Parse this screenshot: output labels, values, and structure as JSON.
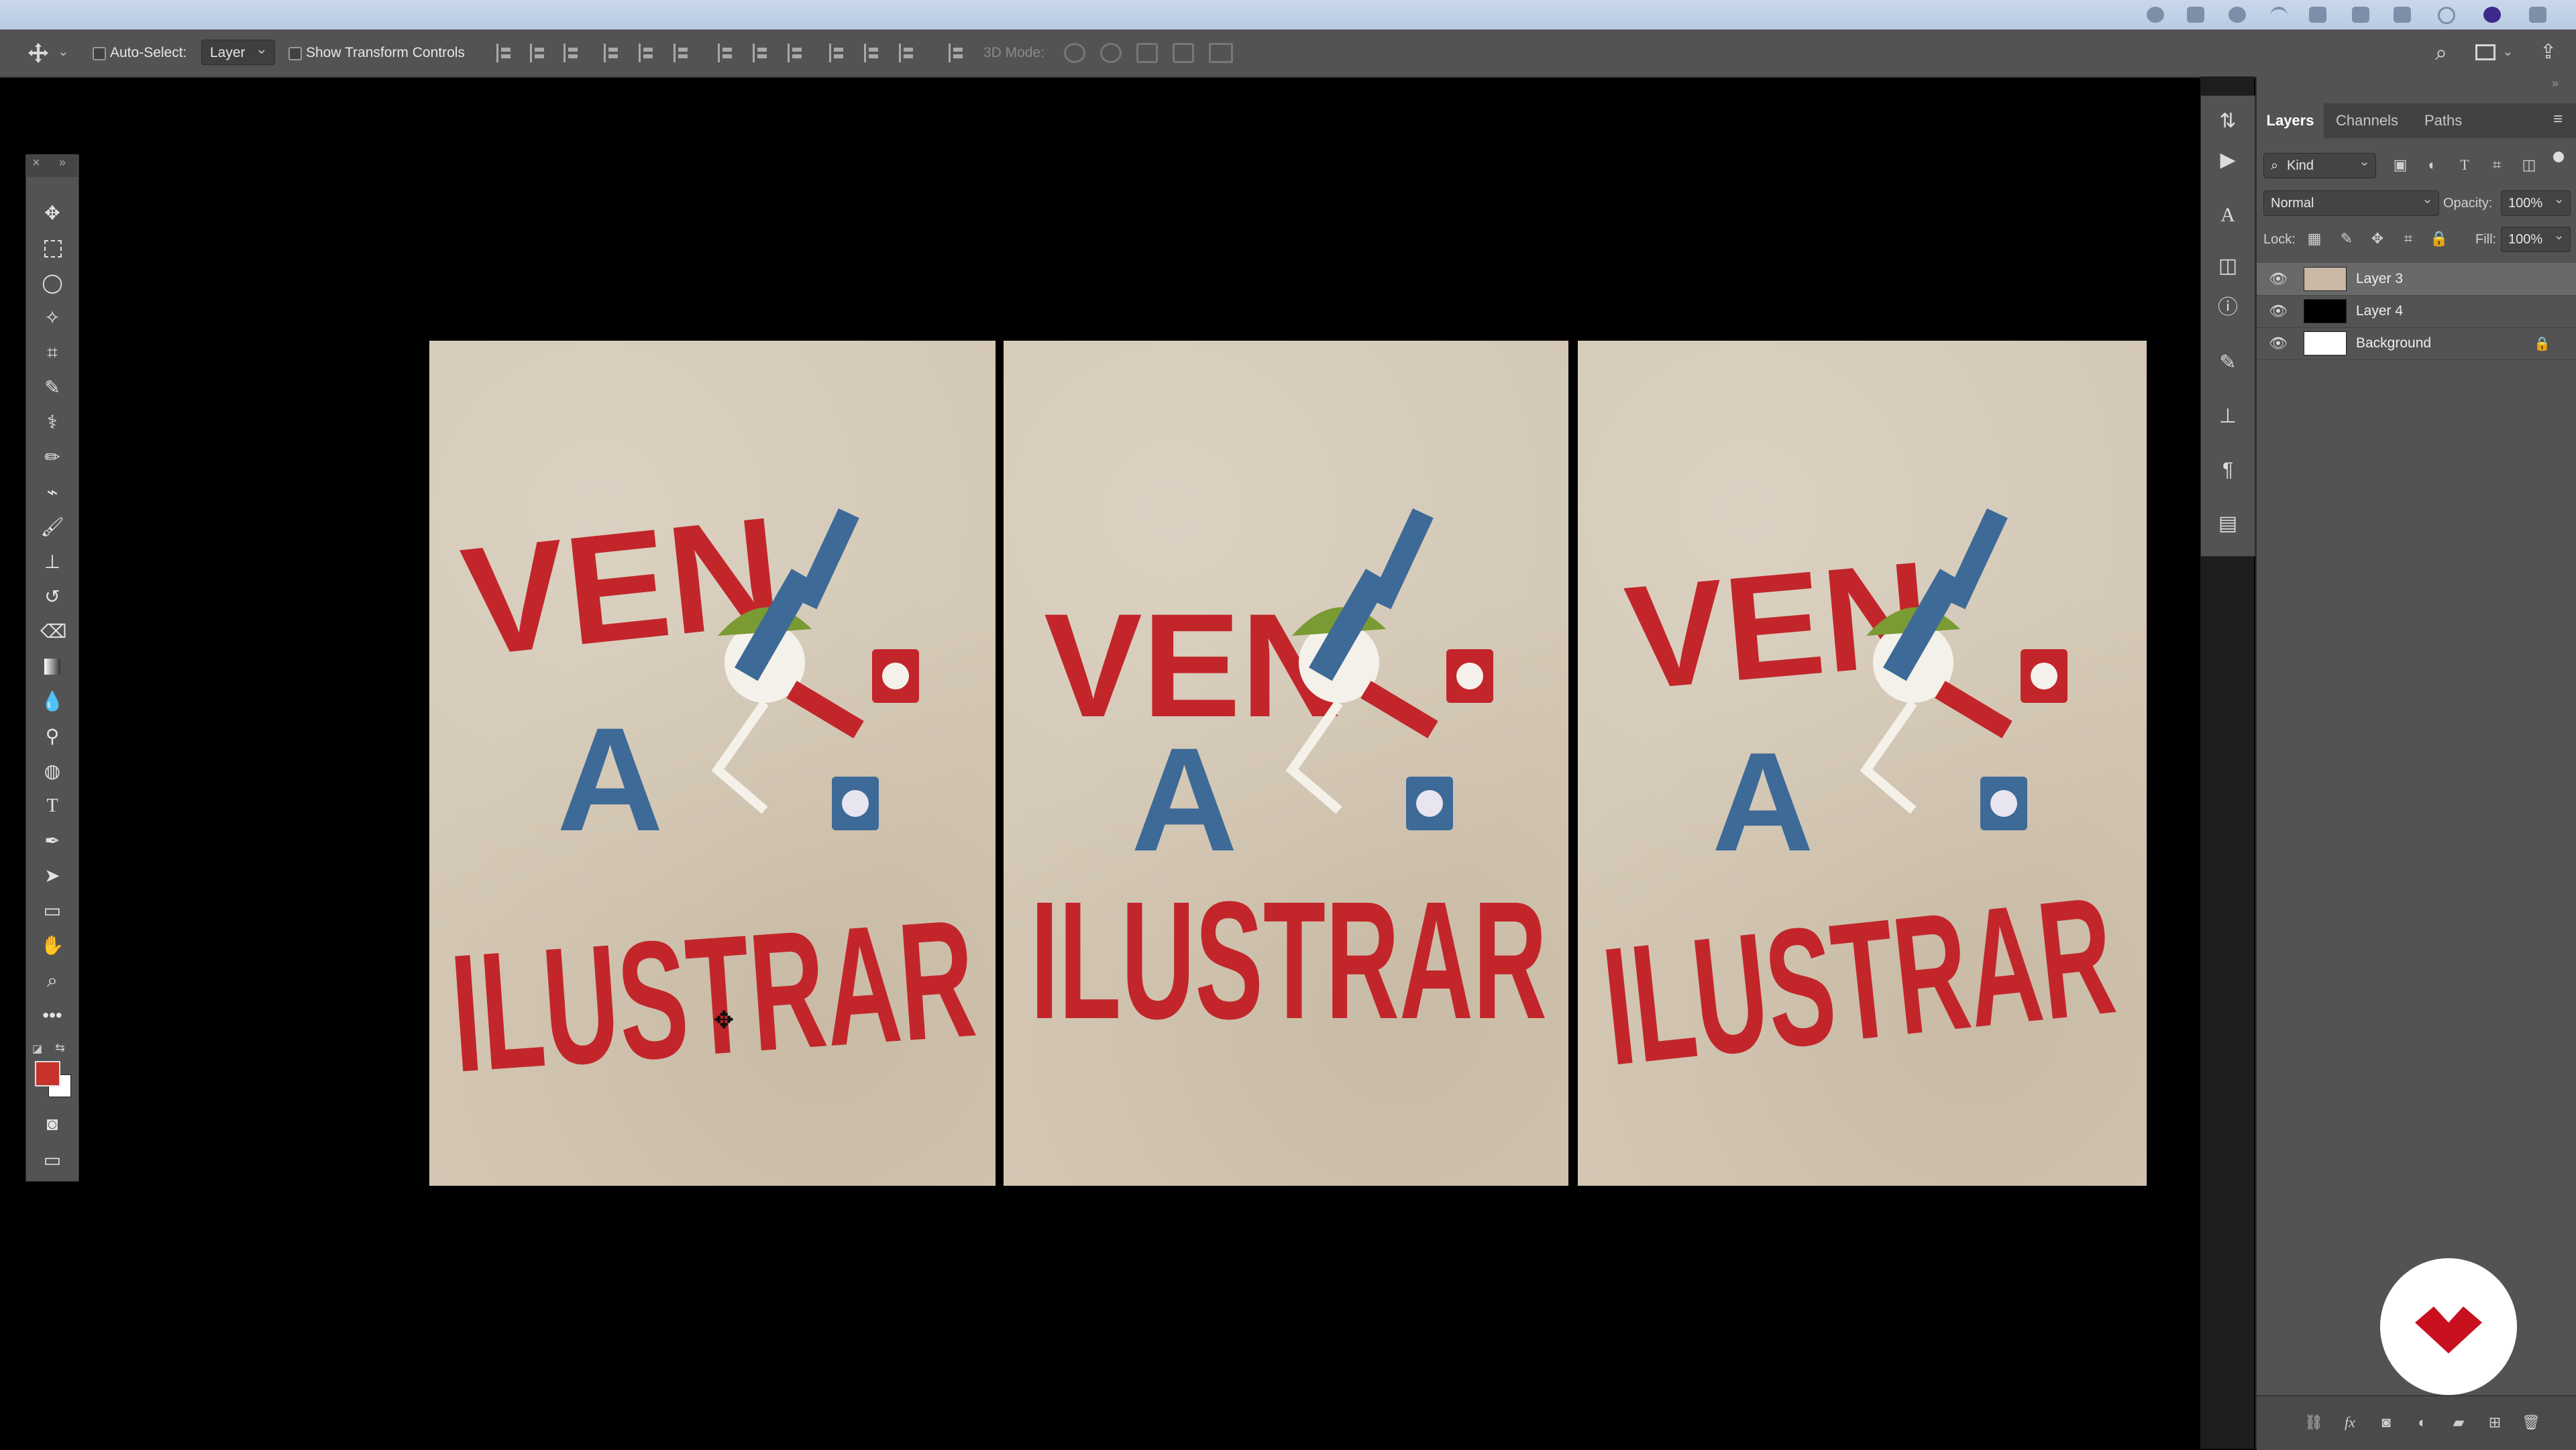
{
  "options_bar": {
    "auto_select_label": "Auto-Select:",
    "auto_select_value": "Layer",
    "transform_controls_label": "Show Transform Controls",
    "mode_3d_label": "3D Mode:"
  },
  "layers_panel": {
    "tabs": [
      "Layers",
      "Channels",
      "Paths"
    ],
    "kind_filter": "Kind",
    "blend_mode": "Normal",
    "opacity_label": "Opacity:",
    "opacity_value": "100%",
    "lock_label": "Lock:",
    "fill_label": "Fill:",
    "fill_value": "100%",
    "layers": [
      {
        "name": "Layer 3",
        "selected": true,
        "thumb": "#c9b9a4"
      },
      {
        "name": "Layer 4",
        "selected": false,
        "thumb": "#000000"
      },
      {
        "name": "Background",
        "selected": false,
        "thumb": "#ffffff",
        "locked": true
      }
    ]
  },
  "posters": [
    {
      "line1": "VEN",
      "line2": "A",
      "line3": "ILUSTRAR"
    },
    {
      "line1": "VEN",
      "line2": "A",
      "line3": "ILUSTRAR"
    },
    {
      "line1": "VEN",
      "line2": "A",
      "line3": "ILUSTRAR"
    }
  ],
  "colors": {
    "foreground": "#c8322c",
    "background": "#ffffff",
    "poster_red": "#c2262b",
    "poster_blue": "#3d6a97",
    "paper": "#d3c7b4",
    "brand": "#c8101e"
  }
}
